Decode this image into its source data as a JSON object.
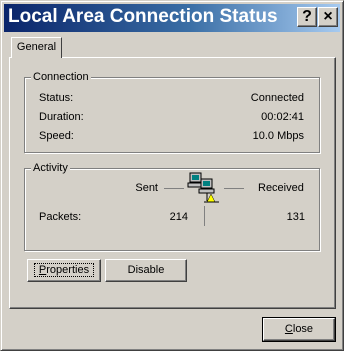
{
  "window": {
    "title": "Local Area Connection Status",
    "help_btn": "?",
    "close_btn": "×"
  },
  "tabs": [
    {
      "label": "General"
    }
  ],
  "connection": {
    "legend": "Connection",
    "status_label": "Status:",
    "status_value": "Connected",
    "duration_label": "Duration:",
    "duration_value": "00:02:41",
    "speed_label": "Speed:",
    "speed_value": "10.0 Mbps"
  },
  "activity": {
    "legend": "Activity",
    "sent_label": "Sent",
    "received_label": "Received",
    "packets_label": "Packets:",
    "packets_sent": "214",
    "packets_received": "131",
    "icon": "network-computers-icon"
  },
  "buttons": {
    "properties_first": "P",
    "properties_rest": "roperties",
    "disable": "Disable",
    "close_first": "C",
    "close_rest": "lose"
  }
}
